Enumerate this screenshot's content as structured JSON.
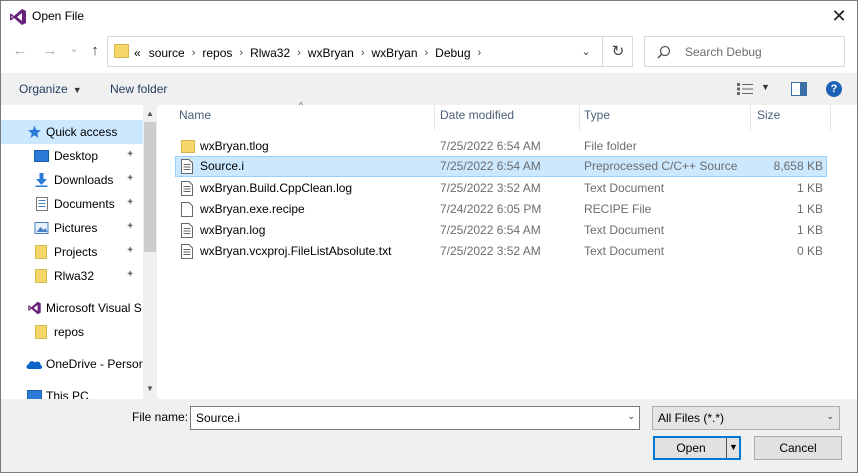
{
  "window": {
    "title": "Open File",
    "close_glyph": "✕"
  },
  "nav": {
    "back_glyph": "←",
    "forward_glyph": "→",
    "recent_glyph": "⌄",
    "up_glyph": "↑",
    "overflow": "«",
    "breadcrumbs": [
      "source",
      "repos",
      "Rlwa32",
      "wxBryan",
      "wxBryan",
      "Debug"
    ],
    "crumb_sep": "›",
    "refresh_glyph": "↻"
  },
  "search": {
    "placeholder": "Search Debug"
  },
  "toolbar": {
    "organize_label": "Organize",
    "new_folder_label": "New folder",
    "dd_glyph": "▼",
    "help_glyph": "?"
  },
  "sidebar": {
    "items": [
      {
        "label": "Quick access",
        "icon": "star-icon",
        "pinned": false
      },
      {
        "label": "Desktop",
        "icon": "desktop-icon",
        "pinned": true
      },
      {
        "label": "Downloads",
        "icon": "download-icon",
        "pinned": true
      },
      {
        "label": "Documents",
        "icon": "documents-icon",
        "pinned": true
      },
      {
        "label": "Pictures",
        "icon": "pictures-icon",
        "pinned": true
      },
      {
        "label": "Projects",
        "icon": "folder-icon",
        "pinned": true
      },
      {
        "label": "Rlwa32",
        "icon": "folder-icon",
        "pinned": true
      },
      {
        "label": "Microsoft Visual S",
        "icon": "visual-studio-icon",
        "pinned": false
      },
      {
        "label": "repos",
        "icon": "folder-icon",
        "pinned": false
      },
      {
        "label": "OneDrive - Persor",
        "icon": "onedrive-icon",
        "pinned": false
      },
      {
        "label": "This PC",
        "icon": "this-pc-icon",
        "pinned": false
      }
    ],
    "pin_glyph": "📌",
    "scroll_up_glyph": "▲",
    "scroll_down_glyph": "▼"
  },
  "file_list": {
    "columns": {
      "name": "Name",
      "date": "Date modified",
      "type": "Type",
      "size": "Size"
    },
    "sort_glyph": "^",
    "rows": [
      {
        "name": "wxBryan.tlog",
        "date": "7/25/2022 6:54 AM",
        "type": "File folder",
        "size": "",
        "icon": "folder-icon",
        "selected": false
      },
      {
        "name": "Source.i",
        "date": "7/25/2022 6:54 AM",
        "type": "Preprocessed C/C++ Source",
        "size": "8,658 KB",
        "icon": "text-file-icon",
        "selected": true
      },
      {
        "name": "wxBryan.Build.CppClean.log",
        "date": "7/25/2022 3:52 AM",
        "type": "Text Document",
        "size": "1 KB",
        "icon": "text-file-icon",
        "selected": false
      },
      {
        "name": "wxBryan.exe.recipe",
        "date": "7/24/2022 6:05 PM",
        "type": "RECIPE File",
        "size": "1 KB",
        "icon": "blank-file-icon",
        "selected": false
      },
      {
        "name": "wxBryan.log",
        "date": "7/25/2022 6:54 AM",
        "type": "Text Document",
        "size": "1 KB",
        "icon": "text-file-icon",
        "selected": false
      },
      {
        "name": "wxBryan.vcxproj.FileListAbsolute.txt",
        "date": "7/25/2022 3:52 AM",
        "type": "Text Document",
        "size": "0 KB",
        "icon": "text-file-icon",
        "selected": false
      }
    ]
  },
  "footer": {
    "file_name_label": "File name:",
    "file_name_value": "Source.i",
    "filter_value": "All Files (*.*)",
    "dd_glyph": "⌄",
    "open_label": "Open",
    "open_dd_glyph": "▼",
    "cancel_label": "Cancel"
  },
  "colors": {
    "selection": "#cce8ff",
    "selection_border": "#99d1ff",
    "folder": "#f5d66b",
    "accent": "#0078d7",
    "vs_purple": "#68217a"
  }
}
